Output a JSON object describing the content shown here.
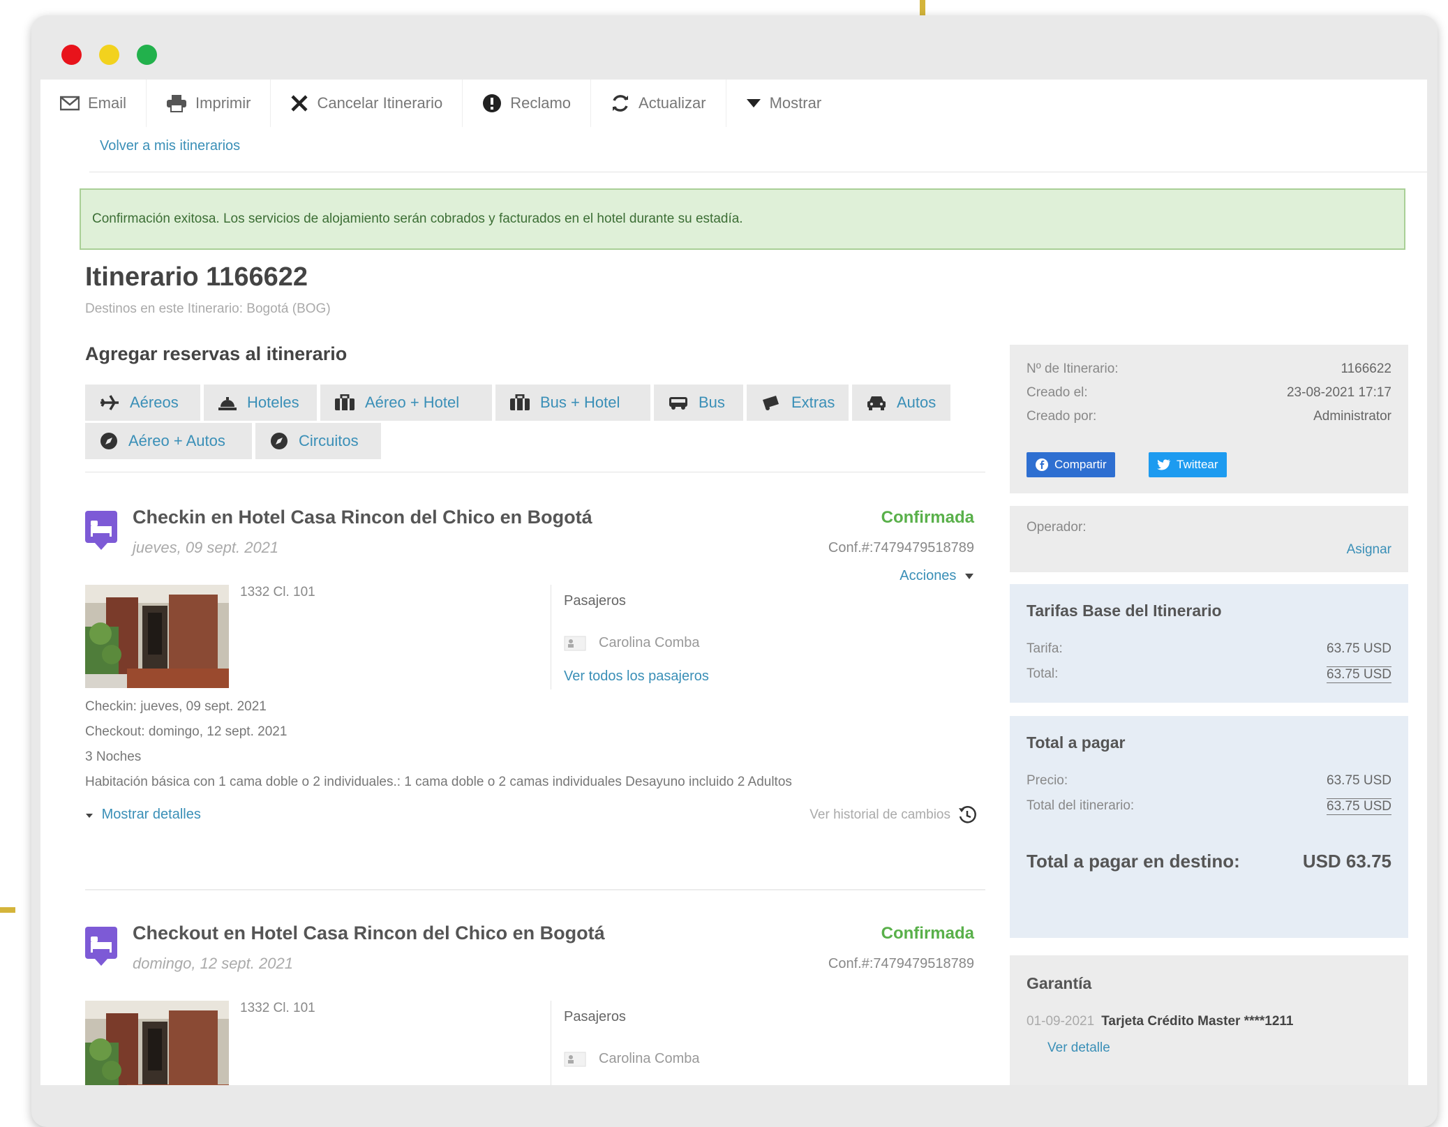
{
  "window": {
    "dot_colors": [
      "#e8131b",
      "#f2d21e",
      "#22b14c"
    ]
  },
  "toolbar": {
    "items": [
      {
        "label": "Email",
        "icon": "envelope-icon"
      },
      {
        "label": "Imprimir",
        "icon": "printer-icon"
      },
      {
        "label": "Cancelar Itinerario",
        "icon": "close-icon"
      },
      {
        "label": "Reclamo",
        "icon": "exclamation-icon"
      },
      {
        "label": "Actualizar",
        "icon": "refresh-icon"
      },
      {
        "label": "Mostrar",
        "icon": "caret-down-icon"
      }
    ],
    "back_link": "Volver a mis itinerarios"
  },
  "alert": {
    "text": "Confirmación exitosa. Los servicios de alojamiento serán cobrados y facturados en el hotel durante su estadía."
  },
  "itinerary": {
    "title": "Itinerario 1166622",
    "destinations": "Destinos en este Itinerario: Bogotá (BOG)"
  },
  "add_bookings": {
    "title": "Agregar reservas al itinerario",
    "buttons": [
      {
        "label": "Aéreos",
        "icon": "plane-icon"
      },
      {
        "label": "Hoteles",
        "icon": "bell-icon"
      },
      {
        "label": "Aéreo + Hotel",
        "icon": "suitcase-icon"
      },
      {
        "label": "Bus + Hotel",
        "icon": "suitcase-icon"
      },
      {
        "label": "Bus",
        "icon": "bus-icon"
      },
      {
        "label": "Extras",
        "icon": "ticket-icon"
      },
      {
        "label": "Autos",
        "icon": "car-icon"
      },
      {
        "label": "Aéreo + Autos",
        "icon": "compass-icon"
      },
      {
        "label": "Circuitos",
        "icon": "compass-icon"
      }
    ]
  },
  "bookings": [
    {
      "title": "Checkin en Hotel Casa Rincon del Chico en Bogotá",
      "date": "jueves, 09 sept. 2021",
      "status": "Confirmada",
      "conf": "Conf.#:7479479518789",
      "actions": "Acciones",
      "address": "1332 Cl. 101",
      "passengers_title": "Pasajeros",
      "passenger_name": "Carolina Comba",
      "all_passengers": "Ver todos los pasajeros",
      "checkin": "Checkin: jueves, 09 sept. 2021",
      "checkout": "Checkout: domingo, 12 sept. 2021",
      "nights": "3 Noches",
      "room": "Habitación básica con 1 cama doble o 2 individuales.: 1 cama doble o 2 camas individuales Desayuno incluido 2 Adultos",
      "show_details": "Mostrar detalles",
      "history": "Ver historial de cambios"
    },
    {
      "title": "Checkout en Hotel Casa Rincon del Chico en Bogotá",
      "date": "domingo, 12 sept. 2021",
      "status": "Confirmada",
      "conf": "Conf.#:7479479518789",
      "address": "1332 Cl. 101",
      "passengers_title": "Pasajeros",
      "passenger_name": "Carolina Comba"
    }
  ],
  "info_panel": {
    "rows": [
      {
        "label": "Nº de Itinerario:",
        "value": "1166622"
      },
      {
        "label": "Creado el:",
        "value": "23-08-2021 17:17"
      },
      {
        "label": "Creado por:",
        "value": "Administrator"
      }
    ],
    "share": "Compartir",
    "tweet": "Twittear"
  },
  "operator": {
    "label": "Operador:",
    "assign": "Asignar"
  },
  "base_rates": {
    "title": "Tarifas Base del Itinerario",
    "rows": [
      {
        "label": "Tarifa:",
        "value": "63.75 USD"
      },
      {
        "label": "Total:",
        "value": "63.75 USD"
      }
    ]
  },
  "total": {
    "title": "Total a pagar",
    "rows": [
      {
        "label": "Precio:",
        "value": "63.75 USD"
      },
      {
        "label": "Total del itinerario:",
        "value": "63.75 USD"
      }
    ],
    "dest_label": "Total a pagar en destino:",
    "dest_value": "USD 63.75"
  },
  "guarantee": {
    "title": "Garantía",
    "date": "01-09-2021",
    "card": "Tarjeta Crédito Master ****1211",
    "detail": "Ver detalle"
  }
}
